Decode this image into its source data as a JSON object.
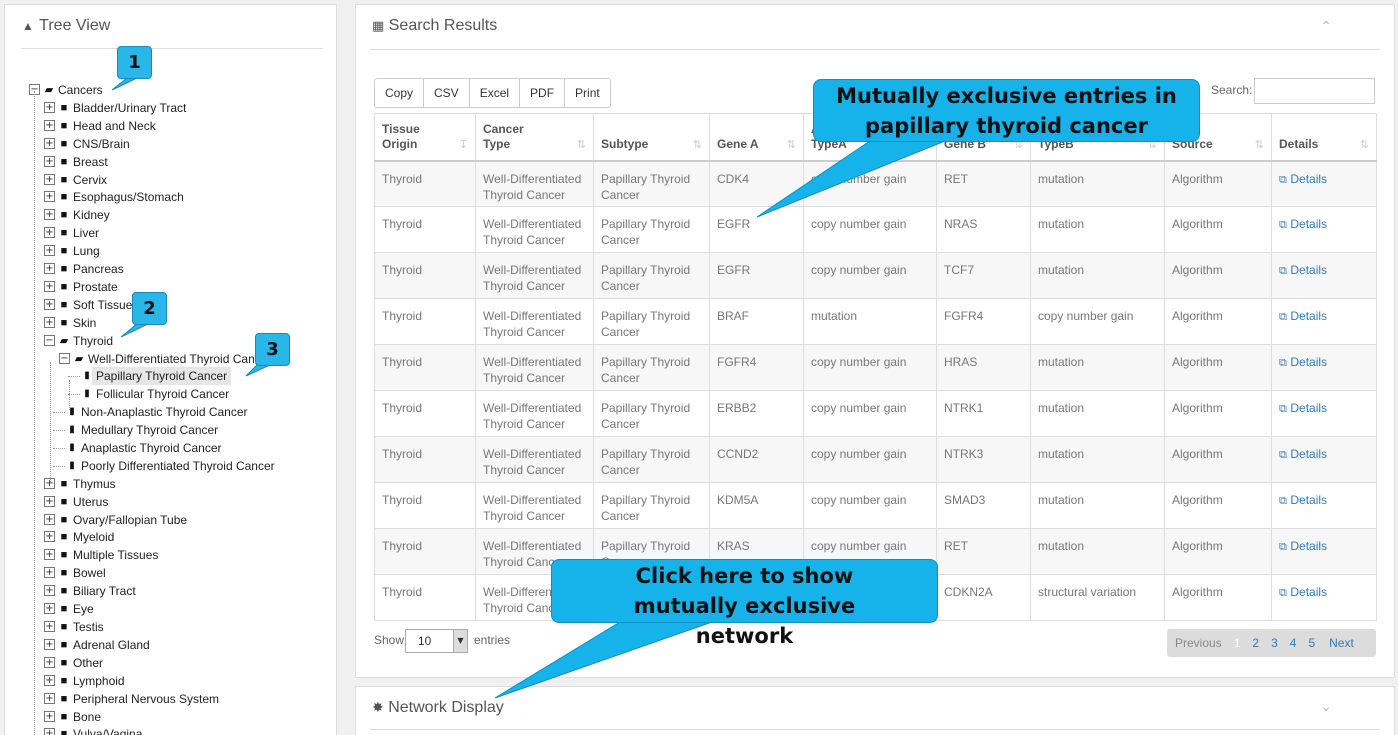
{
  "tree": {
    "title": "Tree View",
    "items": [
      {
        "label": "Cancers",
        "level": 0,
        "state": "open",
        "kind": "folder"
      },
      {
        "label": "Bladder/Urinary Tract",
        "level": 1,
        "state": "closed",
        "kind": "folder"
      },
      {
        "label": "Head and Neck",
        "level": 1,
        "state": "closed",
        "kind": "folder"
      },
      {
        "label": "CNS/Brain",
        "level": 1,
        "state": "closed",
        "kind": "folder"
      },
      {
        "label": "Breast",
        "level": 1,
        "state": "closed",
        "kind": "folder"
      },
      {
        "label": "Cervix",
        "level": 1,
        "state": "closed",
        "kind": "folder"
      },
      {
        "label": "Esophagus/Stomach",
        "level": 1,
        "state": "closed",
        "kind": "folder"
      },
      {
        "label": "Kidney",
        "level": 1,
        "state": "closed",
        "kind": "folder"
      },
      {
        "label": "Liver",
        "level": 1,
        "state": "closed",
        "kind": "folder"
      },
      {
        "label": "Lung",
        "level": 1,
        "state": "closed",
        "kind": "folder"
      },
      {
        "label": "Pancreas",
        "level": 1,
        "state": "closed",
        "kind": "folder"
      },
      {
        "label": "Prostate",
        "level": 1,
        "state": "closed",
        "kind": "folder"
      },
      {
        "label": "Soft Tissue",
        "level": 1,
        "state": "closed",
        "kind": "folder"
      },
      {
        "label": "Skin",
        "level": 1,
        "state": "closed",
        "kind": "folder"
      },
      {
        "label": "Thyroid",
        "level": 1,
        "state": "open",
        "kind": "folder"
      },
      {
        "label": "Well-Differentiated Thyroid Cancer",
        "level": 2,
        "state": "open",
        "kind": "folder"
      },
      {
        "label": "Papillary Thyroid Cancer",
        "level": 3,
        "state": "leaf",
        "kind": "file",
        "selected": true
      },
      {
        "label": "Follicular Thyroid Cancer",
        "level": 3,
        "state": "leaf",
        "kind": "file"
      },
      {
        "label": "Non-Anaplastic Thyroid Cancer",
        "level": 2,
        "state": "leaf",
        "kind": "file"
      },
      {
        "label": "Medullary Thyroid Cancer",
        "level": 2,
        "state": "leaf",
        "kind": "file"
      },
      {
        "label": "Anaplastic Thyroid Cancer",
        "level": 2,
        "state": "leaf",
        "kind": "file"
      },
      {
        "label": "Poorly Differentiated Thyroid Cancer",
        "level": 2,
        "state": "leaf",
        "kind": "file"
      },
      {
        "label": "Thymus",
        "level": 1,
        "state": "closed",
        "kind": "folder"
      },
      {
        "label": "Uterus",
        "level": 1,
        "state": "closed",
        "kind": "folder"
      },
      {
        "label": "Ovary/Fallopian Tube",
        "level": 1,
        "state": "closed",
        "kind": "folder"
      },
      {
        "label": "Myeloid",
        "level": 1,
        "state": "closed",
        "kind": "folder"
      },
      {
        "label": "Multiple Tissues",
        "level": 1,
        "state": "closed",
        "kind": "folder"
      },
      {
        "label": "Bowel",
        "level": 1,
        "state": "closed",
        "kind": "folder"
      },
      {
        "label": "Biliary Tract",
        "level": 1,
        "state": "closed",
        "kind": "folder"
      },
      {
        "label": "Eye",
        "level": 1,
        "state": "closed",
        "kind": "folder"
      },
      {
        "label": "Testis",
        "level": 1,
        "state": "closed",
        "kind": "folder"
      },
      {
        "label": "Adrenal Gland",
        "level": 1,
        "state": "closed",
        "kind": "folder"
      },
      {
        "label": "Other",
        "level": 1,
        "state": "closed",
        "kind": "folder"
      },
      {
        "label": "Lymphoid",
        "level": 1,
        "state": "closed",
        "kind": "folder"
      },
      {
        "label": "Peripheral Nervous System",
        "level": 1,
        "state": "closed",
        "kind": "folder"
      },
      {
        "label": "Bone",
        "level": 1,
        "state": "closed",
        "kind": "folder"
      },
      {
        "label": "Vulva/Vagina",
        "level": 1,
        "state": "closed",
        "kind": "folder"
      }
    ]
  },
  "results": {
    "title": "Search Results",
    "buttons": [
      "Copy",
      "CSV",
      "Excel",
      "PDF",
      "Print"
    ],
    "search_label": "Search:",
    "search_value": "",
    "columns": [
      "Tissue Origin",
      "Cancer Type",
      "Subtype",
      "Gene A",
      "Aberrance TypeA",
      "Gene B",
      "Aberrance TypeB",
      "Source",
      "Details"
    ],
    "rows": [
      [
        "Thyroid",
        "Well-Differentiated Thyroid Cancer",
        "Papillary Thyroid Cancer",
        "CDK4",
        "copy number gain",
        "RET",
        "mutation",
        "Algorithm",
        "Details"
      ],
      [
        "Thyroid",
        "Well-Differentiated Thyroid Cancer",
        "Papillary Thyroid Cancer",
        "EGFR",
        "copy number gain",
        "NRAS",
        "mutation",
        "Algorithm",
        "Details"
      ],
      [
        "Thyroid",
        "Well-Differentiated Thyroid Cancer",
        "Papillary Thyroid Cancer",
        "EGFR",
        "copy number gain",
        "TCF7",
        "mutation",
        "Algorithm",
        "Details"
      ],
      [
        "Thyroid",
        "Well-Differentiated Thyroid Cancer",
        "Papillary Thyroid Cancer",
        "BRAF",
        "mutation",
        "FGFR4",
        "copy number gain",
        "Algorithm",
        "Details"
      ],
      [
        "Thyroid",
        "Well-Differentiated Thyroid Cancer",
        "Papillary Thyroid Cancer",
        "FGFR4",
        "copy number gain",
        "HRAS",
        "mutation",
        "Algorithm",
        "Details"
      ],
      [
        "Thyroid",
        "Well-Differentiated Thyroid Cancer",
        "Papillary Thyroid Cancer",
        "ERBB2",
        "copy number gain",
        "NTRK1",
        "mutation",
        "Algorithm",
        "Details"
      ],
      [
        "Thyroid",
        "Well-Differentiated Thyroid Cancer",
        "Papillary Thyroid Cancer",
        "CCND2",
        "copy number gain",
        "NTRK3",
        "mutation",
        "Algorithm",
        "Details"
      ],
      [
        "Thyroid",
        "Well-Differentiated Thyroid Cancer",
        "Papillary Thyroid Cancer",
        "KDM5A",
        "copy number gain",
        "SMAD3",
        "mutation",
        "Algorithm",
        "Details"
      ],
      [
        "Thyroid",
        "Well-Differentiated Thyroid Cancer",
        "Papillary Thyroid Cancer",
        "KRAS",
        "copy number gain",
        "RET",
        "mutation",
        "Algorithm",
        "Details"
      ],
      [
        "Thyroid",
        "Well-Differentiated Thyroid Cancer",
        "Papillary Thyroid Cancer",
        "",
        "",
        "CDKN2A",
        "structural variation",
        "Algorithm",
        "Details"
      ]
    ],
    "show_label": "Show",
    "page_size": "10",
    "entries_label": "entries",
    "pager": {
      "previous": "Previous",
      "pages": [
        "1",
        "2",
        "3",
        "4",
        "5"
      ],
      "current": "1",
      "next": "Next"
    }
  },
  "network": {
    "title": "Network Display"
  },
  "annotations": {
    "badges": [
      "1",
      "2",
      "3"
    ],
    "callout_top": "Mutually exclusive entries in papillary thyroid cancer",
    "callout_bottom": "Click here to show mutually exclusive network"
  },
  "colors": {
    "callout": "#16b2ea",
    "link": "#337ab7"
  }
}
